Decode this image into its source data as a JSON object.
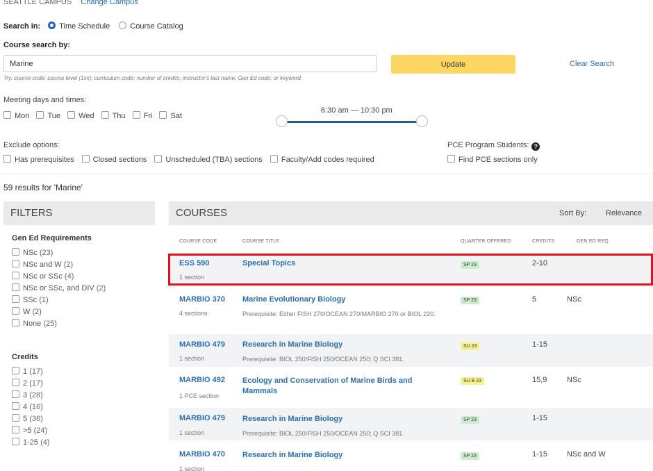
{
  "campus": {
    "label": "SEATTLE CAMPUS",
    "change": "Change Campus"
  },
  "search_in": {
    "label": "Search in:",
    "options": [
      "Time Schedule",
      "Course Catalog"
    ],
    "selected": "Time Schedule"
  },
  "course_search": {
    "label": "Course search by:",
    "value": "Marine",
    "hint": "Try: course code; course level (1xx); curriculum code; number of credits; instructor's last name; Gen Ed code; or keyword.",
    "update": "Update",
    "clear": "Clear Search"
  },
  "meeting": {
    "label": "Meeting days and times:",
    "days": [
      "Mon",
      "Tue",
      "Wed",
      "Thu",
      "Fri",
      "Sat"
    ],
    "time_range": "6:30 am — 10:30 pm"
  },
  "exclude": {
    "label": "Exclude options:",
    "options": [
      "Has prerequisites",
      "Closed sections",
      "Unscheduled (TBA) sections",
      "Faculty/Add codes required"
    ]
  },
  "pce": {
    "label": "PCE Program Students:",
    "help": "?",
    "option": "Find PCE sections only"
  },
  "results_text": "59 results for 'Marine'",
  "filters": {
    "title": "FILTERS",
    "gen_ed_title": "Gen Ed Requirements",
    "gen_ed": [
      {
        "label": "NSc",
        "count": "(23)"
      },
      {
        "label": "NSc and W",
        "count": "(2)"
      },
      {
        "label": "NSc or SSc",
        "count": "(4)"
      },
      {
        "label": "NSc or SSc, and DIV",
        "count": "(2)"
      },
      {
        "label": "SSc",
        "count": "(1)"
      },
      {
        "label": "W",
        "count": "(2)"
      },
      {
        "label": "None",
        "count": "(25)"
      }
    ],
    "credits_title": "Credits",
    "credits": [
      {
        "label": "1",
        "count": "(17)"
      },
      {
        "label": "2",
        "count": "(17)"
      },
      {
        "label": "3",
        "count": "(28)"
      },
      {
        "label": "4",
        "count": "(16)"
      },
      {
        "label": "5",
        "count": "(36)"
      },
      {
        "label": ">5",
        "count": "(24)"
      },
      {
        "label": "1-25",
        "count": "(4)"
      }
    ]
  },
  "courses": {
    "title": "COURSES",
    "sort_label": "Sort By:",
    "sort_value": "Relevance",
    "columns": [
      "COURSE CODE",
      "COURSE TITLE",
      "QUARTER OFFERED",
      "CREDITS",
      "GEN ED REQ"
    ],
    "rows": [
      {
        "code": "ESS 590",
        "sections": "1 section",
        "title": "Special Topics",
        "prereq": "",
        "quarter": "SP 23",
        "credits": "2-10",
        "gened": ""
      },
      {
        "code": "MARBIO 370",
        "sections": "4 sections",
        "title": "Marine Evolutionary Biology",
        "prereq": "Prerequisite: Either FISH 270/OCEAN 270/MARBIO 270 or BIOL 220.",
        "quarter": "SP 23",
        "credits": "5",
        "gened": "NSc"
      },
      {
        "code": "MARBIO 479",
        "sections": "1 section",
        "title": "Research in Marine Biology",
        "prereq": "Prerequisite: BIOL 250/FISH 250/OCEAN 250; Q SCI 381.",
        "quarter": "SU 23",
        "credits": "1-15",
        "gened": ""
      },
      {
        "code": "MARBIO 492",
        "sections": "1 PCE section",
        "title": "Ecology and Conservation of Marine Birds and Mammals",
        "prereq": "",
        "quarter": "SU B 23",
        "credits": "15,9",
        "gened": "NSc"
      },
      {
        "code": "MARBIO 479",
        "sections": "1 section",
        "title": "Research in Marine Biology",
        "prereq": "Prerequisite: BIOL 250/FISH 250/OCEAN 250; Q SCI 381.",
        "quarter": "SP 23",
        "credits": "1-15",
        "gened": ""
      },
      {
        "code": "MARBIO 470",
        "sections": "1 section",
        "title": "Research in Marine Biology",
        "prereq": "",
        "quarter": "SP 23",
        "credits": "1-15",
        "gened": "NSc and W"
      }
    ]
  },
  "colors": {
    "accent": "#2a6fb0",
    "update_button": "#fdd664",
    "highlight": "#e3111a",
    "sp_badge": "#cdeccd",
    "su_badge": "#f7f08e"
  }
}
